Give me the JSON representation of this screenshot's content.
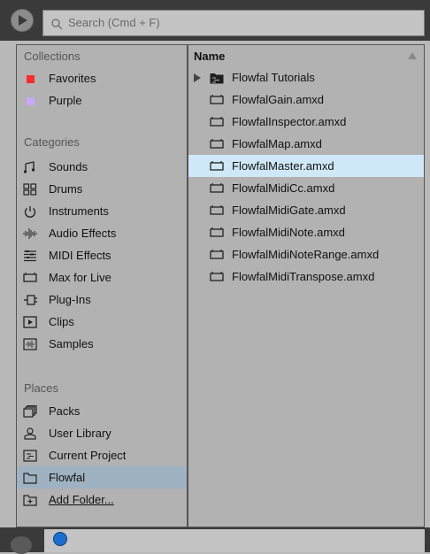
{
  "search": {
    "placeholder": "Search (Cmd + F)"
  },
  "sidebar": {
    "collections_header": "Collections",
    "collections": [
      {
        "label": "Favorites",
        "color": "#ff2a2a"
      },
      {
        "label": "Purple",
        "color": "#c9a8ff"
      }
    ],
    "categories_header": "Categories",
    "categories": [
      {
        "label": "Sounds",
        "icon": "sounds-icon"
      },
      {
        "label": "Drums",
        "icon": "drums-icon"
      },
      {
        "label": "Instruments",
        "icon": "instruments-icon"
      },
      {
        "label": "Audio Effects",
        "icon": "audio-effects-icon"
      },
      {
        "label": "MIDI Effects",
        "icon": "midi-effects-icon"
      },
      {
        "label": "Max for Live",
        "icon": "max-for-live-icon"
      },
      {
        "label": "Plug-Ins",
        "icon": "plug-ins-icon"
      },
      {
        "label": "Clips",
        "icon": "clips-icon"
      },
      {
        "label": "Samples",
        "icon": "samples-icon"
      }
    ],
    "places_header": "Places",
    "places": [
      {
        "label": "Packs",
        "icon": "packs-icon"
      },
      {
        "label": "User Library",
        "icon": "user-library-icon"
      },
      {
        "label": "Current Project",
        "icon": "current-project-icon"
      },
      {
        "label": "Flowfal",
        "icon": "folder-icon",
        "selected": true
      },
      {
        "label": "Add Folder...",
        "icon": "add-folder-icon"
      }
    ]
  },
  "content": {
    "column_header": "Name",
    "items": [
      {
        "label": "Flowfal Tutorials",
        "type": "folder"
      },
      {
        "label": "FlowfalGain.amxd",
        "type": "device"
      },
      {
        "label": "FlowfalInspector.amxd",
        "type": "device"
      },
      {
        "label": "FlowfalMap.amxd",
        "type": "device"
      },
      {
        "label": "FlowfalMaster.amxd",
        "type": "device",
        "selected": true
      },
      {
        "label": "FlowfalMidiCc.amxd",
        "type": "device"
      },
      {
        "label": "FlowfalMidiGate.amxd",
        "type": "device"
      },
      {
        "label": "FlowfalMidiNote.amxd",
        "type": "device"
      },
      {
        "label": "FlowfalMidiNoteRange.amxd",
        "type": "device"
      },
      {
        "label": "FlowfalMidiTranspose.amxd",
        "type": "device"
      }
    ]
  },
  "colors": {
    "selection_sidebar": "#9fb2c2",
    "selection_list": "#cfe8f7",
    "background": "#b2b2b2"
  }
}
